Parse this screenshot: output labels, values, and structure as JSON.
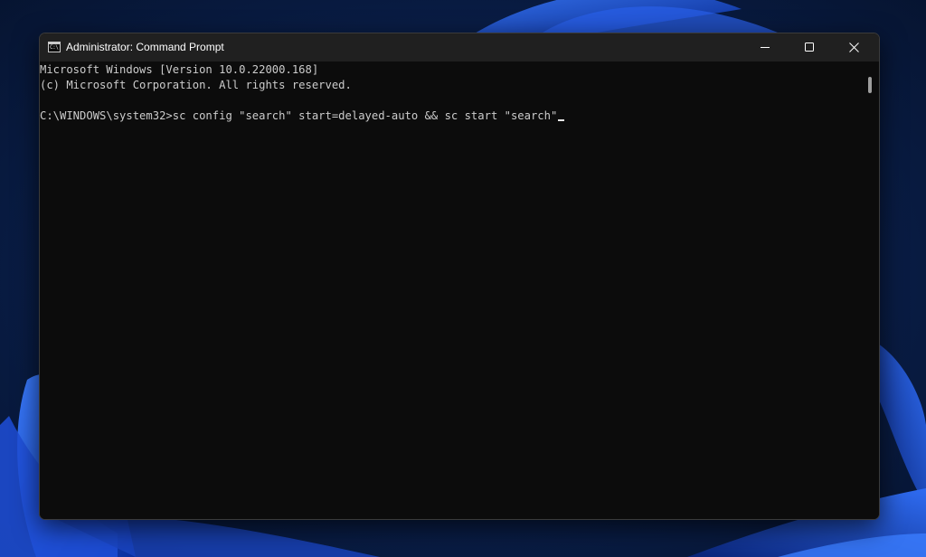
{
  "window": {
    "title": "Administrator: Command Prompt",
    "icon": "command-prompt-icon",
    "icon_glyph": "C:\\",
    "controls": {
      "minimize": "minimize-icon",
      "maximize": "maximize-icon",
      "close": "close-icon"
    }
  },
  "console": {
    "lines": [
      "Microsoft Windows [Version 10.0.22000.168]",
      "(c) Microsoft Corporation. All rights reserved.",
      "",
      "C:\\WINDOWS\\system32>sc config \"search\" start=delayed-auto && sc start \"search\""
    ]
  },
  "colors": {
    "console_background": "#0c0c0c",
    "console_text": "#cccccc",
    "titlebar": "#202020",
    "desktop_accent": "#1d56e0"
  }
}
